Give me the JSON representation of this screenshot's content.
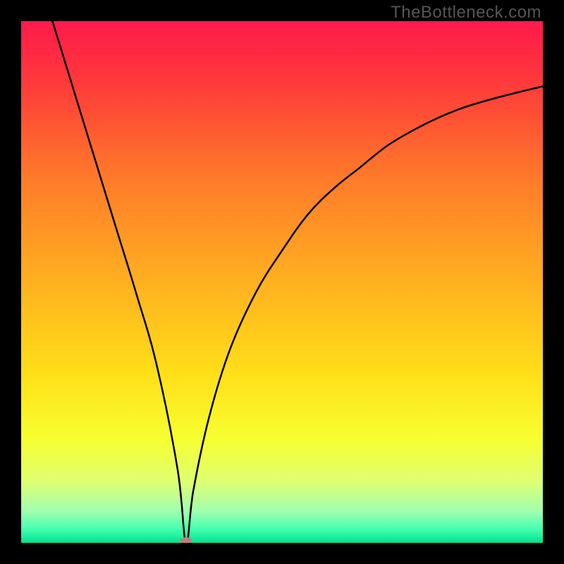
{
  "watermark": "TheBottleneck.com",
  "chart_data": {
    "type": "line",
    "title": "",
    "xlabel": "",
    "ylabel": "",
    "xlim": [
      0,
      100
    ],
    "ylim": [
      0,
      100
    ],
    "series": [
      {
        "name": "bottleneck-curve",
        "x": [
          6,
          10,
          14,
          18,
          22,
          26,
          30,
          31.6,
          33,
          36,
          40,
          45,
          50,
          55,
          60,
          65,
          70,
          75,
          80,
          85,
          90,
          95,
          100
        ],
        "values": [
          100,
          87,
          74,
          61,
          48,
          34,
          14,
          0,
          10,
          24,
          37,
          48,
          56,
          63,
          68,
          72,
          76,
          79,
          81.5,
          83.5,
          85,
          86.3,
          87.5
        ]
      }
    ],
    "marker": {
      "x": 31.6,
      "y": 0,
      "color": "#c97a7a"
    },
    "gradient_stops": [
      {
        "offset": 0.0,
        "color": "#ff1a4b"
      },
      {
        "offset": 0.12,
        "color": "#ff3a3a"
      },
      {
        "offset": 0.3,
        "color": "#ff7a2a"
      },
      {
        "offset": 0.5,
        "color": "#ffb020"
      },
      {
        "offset": 0.68,
        "color": "#ffe018"
      },
      {
        "offset": 0.8,
        "color": "#f7ff30"
      },
      {
        "offset": 0.88,
        "color": "#e0ff70"
      },
      {
        "offset": 0.94,
        "color": "#a0ffb0"
      },
      {
        "offset": 0.975,
        "color": "#40ffb0"
      },
      {
        "offset": 1.0,
        "color": "#00e090"
      }
    ]
  }
}
